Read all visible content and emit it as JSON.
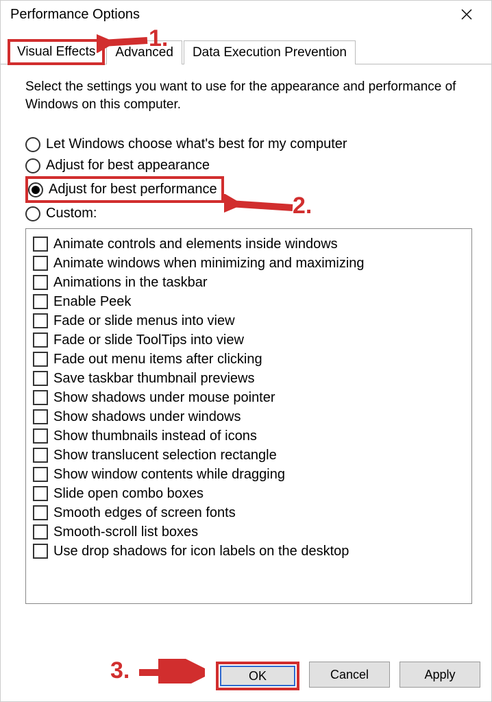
{
  "title": "Performance Options",
  "tabs": [
    {
      "label": "Visual Effects",
      "selected": true
    },
    {
      "label": "Advanced",
      "selected": false
    },
    {
      "label": "Data Execution Prevention",
      "selected": false
    }
  ],
  "intro": "Select the settings you want to use for the appearance and performance of Windows on this computer.",
  "radios": [
    {
      "label": "Let Windows choose what's best for my computer",
      "checked": false
    },
    {
      "label": "Adjust for best appearance",
      "checked": false
    },
    {
      "label": "Adjust for best performance",
      "checked": true
    },
    {
      "label": "Custom:",
      "checked": false
    }
  ],
  "checkboxes": [
    "Animate controls and elements inside windows",
    "Animate windows when minimizing and maximizing",
    "Animations in the taskbar",
    "Enable Peek",
    "Fade or slide menus into view",
    "Fade or slide ToolTips into view",
    "Fade out menu items after clicking",
    "Save taskbar thumbnail previews",
    "Show shadows under mouse pointer",
    "Show shadows under windows",
    "Show thumbnails instead of icons",
    "Show translucent selection rectangle",
    "Show window contents while dragging",
    "Slide open combo boxes",
    "Smooth edges of screen fonts",
    "Smooth-scroll list boxes",
    "Use drop shadows for icon labels on the desktop"
  ],
  "buttons": {
    "ok": "OK",
    "cancel": "Cancel",
    "apply": "Apply"
  },
  "annotations": {
    "n1": "1.",
    "n2": "2.",
    "n3": "3."
  }
}
